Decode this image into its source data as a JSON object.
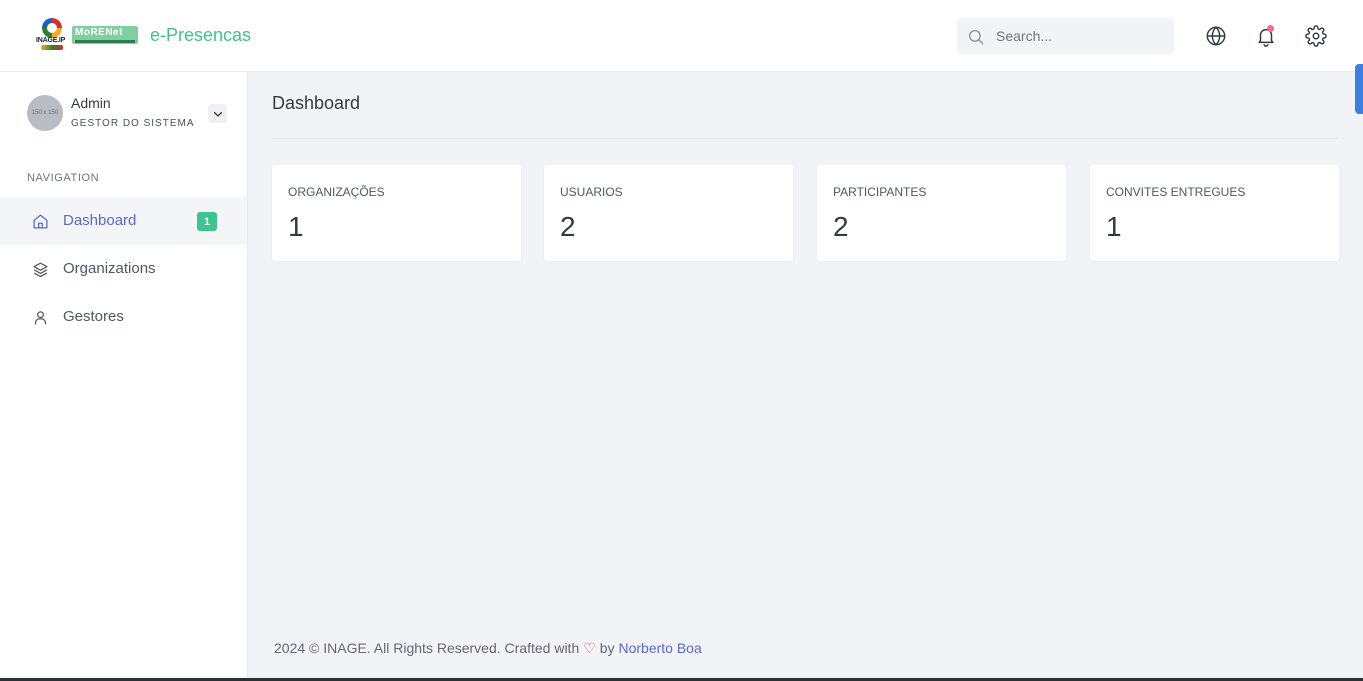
{
  "brand": {
    "logo1_text": "INAGE.IP",
    "logo2_text": "MoRENet",
    "app_name": "e-Presencas"
  },
  "header": {
    "search_placeholder": "Search...",
    "icons": [
      "globe-icon",
      "bell-icon",
      "gear-icon"
    ]
  },
  "user": {
    "avatar_text": "150 x 150",
    "name": "Admin",
    "role": "GESTOR DO SISTEMA"
  },
  "sidebar": {
    "nav_title": "NAVIGATION",
    "items": [
      {
        "label": "Dashboard",
        "icon": "home-icon",
        "badge": "1",
        "active": true
      },
      {
        "label": "Organizations",
        "icon": "layers-icon"
      },
      {
        "label": "Gestores",
        "icon": "user-icon"
      }
    ]
  },
  "main": {
    "title": "Dashboard",
    "cards": [
      {
        "label": "ORGANIZAÇÕES",
        "value": "1"
      },
      {
        "label": "USUARIOS",
        "value": "2"
      },
      {
        "label": "PARTICIPANTES",
        "value": "2"
      },
      {
        "label": "CONVITES ENTREGUES",
        "value": "1"
      }
    ]
  },
  "footer": {
    "text": "2024 © INAGE. All Rights Reserved. Crafted with",
    "heart": "♡",
    "by": "by",
    "author": "Norberto Boa"
  },
  "colors": {
    "accent": "#3ec48e",
    "primary": "#5a68c8",
    "background": "#f2f3f7",
    "notification_dot": "#f06f85",
    "heart": "#e8414c"
  }
}
